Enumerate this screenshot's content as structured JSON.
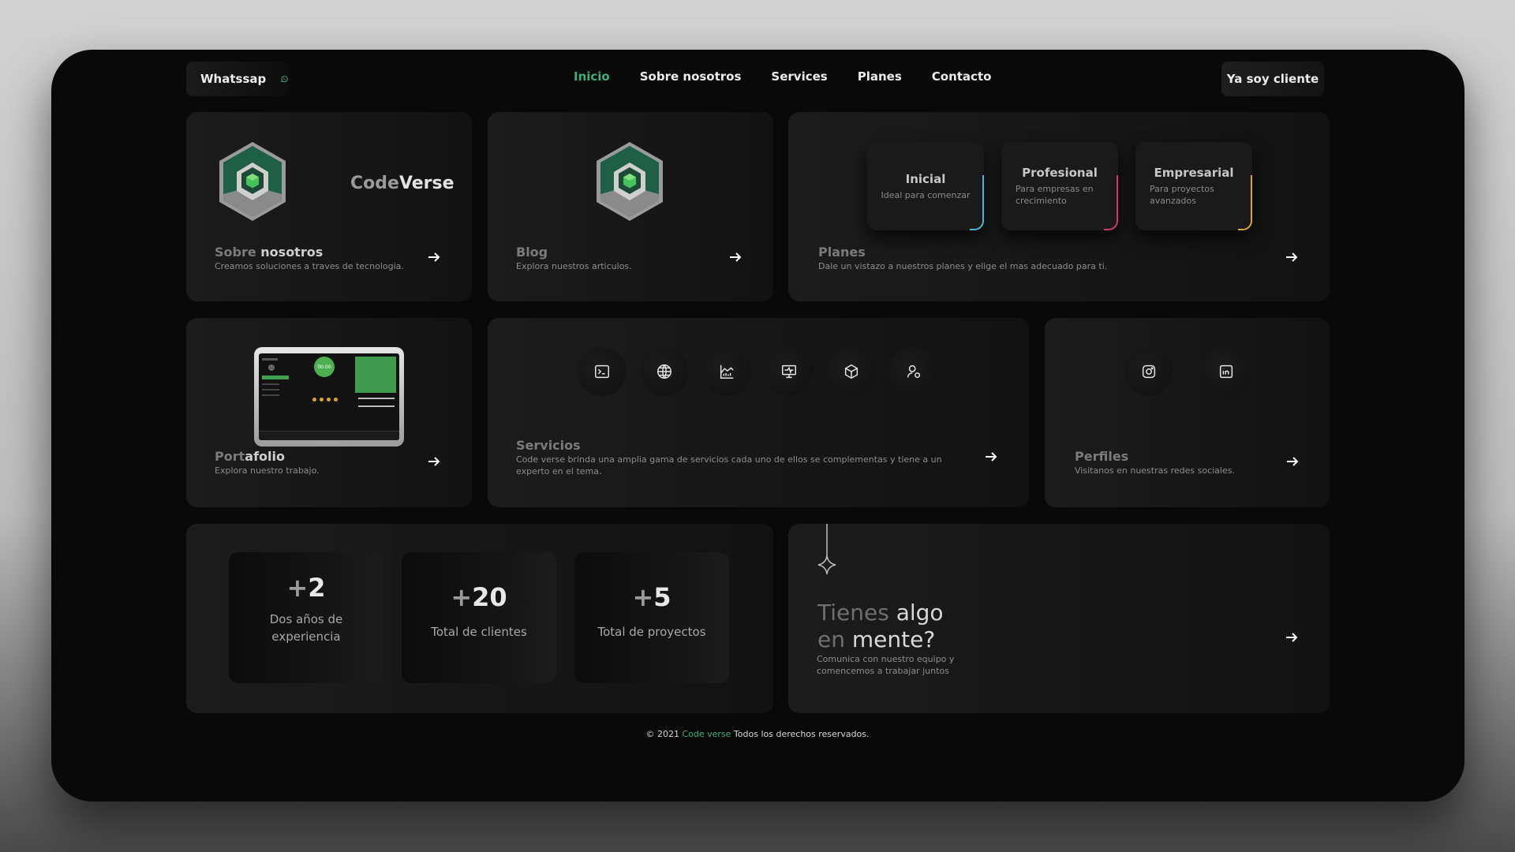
{
  "nav": {
    "whatsapp_label": "Whatssap",
    "links": [
      "Inicio",
      "Sobre nosotros",
      "Services",
      "Planes",
      "Contacto"
    ],
    "active": "Inicio",
    "client_button": "Ya soy cliente"
  },
  "colors": {
    "accent": "#3fb07a",
    "plan_inicial": "#4fb6d6",
    "plan_profesional": "#d0386a",
    "plan_empresarial": "#d9a437"
  },
  "about": {
    "brand_prefix": "Code",
    "brand_suffix": "Verse",
    "title_light": "Sobre ",
    "title_bold": "nosotros",
    "desc": "Creamos soluciones a traves de tecnologia."
  },
  "blog": {
    "title": "Blog",
    "desc": "Explora nuestros articulos."
  },
  "plans": {
    "title": "Planes",
    "desc": "Dale un vistazo a nuestros planes y elige el mas adecuado para ti.",
    "items": [
      {
        "name": "Inicial",
        "desc": "Ideal para comenzar"
      },
      {
        "name": "Profesional",
        "desc": "Para empresas en crecimiento"
      },
      {
        "name": "Empresarial",
        "desc": "Para proyectos avanzados"
      }
    ]
  },
  "portfolio": {
    "title_light": "Port",
    "title_bold": "afolio",
    "desc": "Explora nuestro trabajo.",
    "preview_clock": "00:00"
  },
  "services": {
    "title": "Servicios",
    "desc": "Code verse brinda una amplia gama de servicios cada uno de ellos se complementas y tiene a un experto en el tema.",
    "icons": [
      "terminal-icon",
      "globe-icon",
      "chart-icon",
      "monitor-icon",
      "cube-icon",
      "user-settings-icon"
    ]
  },
  "profiles": {
    "title": "Perfiles",
    "desc": "Visitanos en nuestras redes sociales.",
    "icons": [
      "instagram-icon",
      "linkedin-icon"
    ]
  },
  "stats": [
    {
      "prefix": "+",
      "value": "2",
      "label": "Dos años de experiencia"
    },
    {
      "prefix": "+",
      "value": "20",
      "label": "Total de clientes"
    },
    {
      "prefix": "+",
      "value": "5",
      "label": "Total de proyectos"
    }
  ],
  "cta": {
    "line1_light": "Tienes ",
    "line1_bold": "algo",
    "line2_light": "en ",
    "line2_bold": "mente?",
    "desc_line1": "Comunica con nuestro equipo y",
    "desc_line2": "comencemos a trabajar juntos"
  },
  "footer": {
    "prefix": "© 2021 ",
    "brand": "Code verse",
    "suffix": " Todos los derechos reservados."
  }
}
